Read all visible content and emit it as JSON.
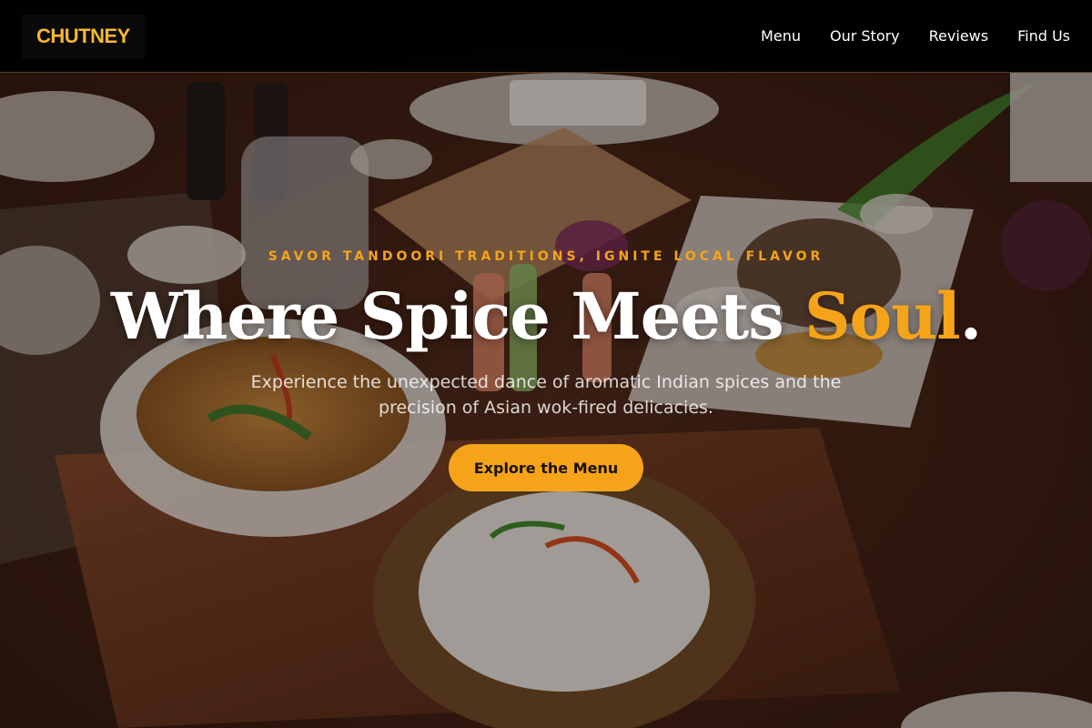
{
  "brand": {
    "name": "CHUTNEY"
  },
  "nav": {
    "items": [
      {
        "label": "Menu"
      },
      {
        "label": "Our Story"
      },
      {
        "label": "Reviews"
      },
      {
        "label": "Find Us"
      }
    ]
  },
  "hero": {
    "tagline": "SAVOR TANDOORI TRADITIONS, IGNITE LOCAL FLAVOR",
    "headline_main": "Where Spice Meets ",
    "headline_accent": "Soul",
    "headline_end": ".",
    "subtitle": "Experience the unexpected dance of aromatic Indian spices and the precision of Asian wok-fired delicacies.",
    "cta_label": "Explore the Menu",
    "background_image": "table-spread-of-asian-dishes"
  },
  "colors": {
    "accent": "#f5a419",
    "header_bg": "#000000",
    "logo_text": "#f5b82e",
    "text": "#ffffff"
  }
}
